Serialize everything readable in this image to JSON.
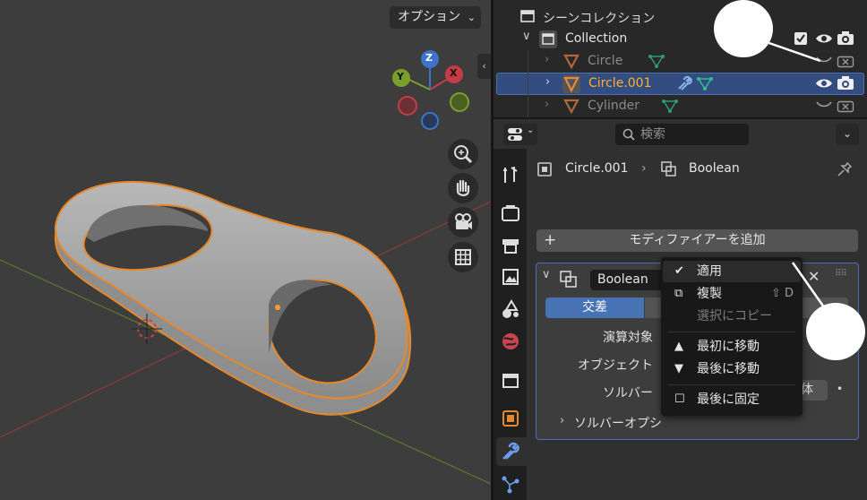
{
  "viewport": {
    "options_label": "オプション",
    "gizmo": {
      "z": "Z",
      "y": "Y",
      "x": "X"
    }
  },
  "outliner": {
    "title": "シーンコレクション",
    "collection": "Collection",
    "items": [
      {
        "name": "Circle",
        "selected": false
      },
      {
        "name": "Circle.001",
        "selected": true
      },
      {
        "name": "Cylinder",
        "selected": false
      }
    ]
  },
  "properties": {
    "search_placeholder": "検索",
    "breadcrumb": {
      "object": "Circle.001",
      "modifier": "Boolean"
    },
    "add_modifier": "モディファイアーを追加",
    "modifier": {
      "name": "Boolean",
      "operation_active": "交差",
      "operand_type_label": "演算対象",
      "object_label": "オブジェクト",
      "solver_label": "ソルバー",
      "solver_value_partial": "体",
      "solver_options": "ソルバーオプシ"
    }
  },
  "menu": {
    "items": [
      {
        "icon": "check-icon",
        "label": "適用",
        "shortcut": ""
      },
      {
        "icon": "duplicate-icon",
        "label": "複製",
        "shortcut": "⇧ D"
      },
      {
        "icon": "",
        "label": "選択にコピー",
        "shortcut": "",
        "disabled": true
      },
      {
        "icon": "triangle-up-icon",
        "label": "最初に移動",
        "shortcut": ""
      },
      {
        "icon": "triangle-down-icon",
        "label": "最後に移動",
        "shortcut": ""
      },
      {
        "icon": "checkbox-icon",
        "label": "最後に固定",
        "shortcut": ""
      }
    ]
  },
  "colors": {
    "accent": "#4772b3",
    "selection_orange": "#f5a623",
    "active_text": "#ffaf29"
  }
}
